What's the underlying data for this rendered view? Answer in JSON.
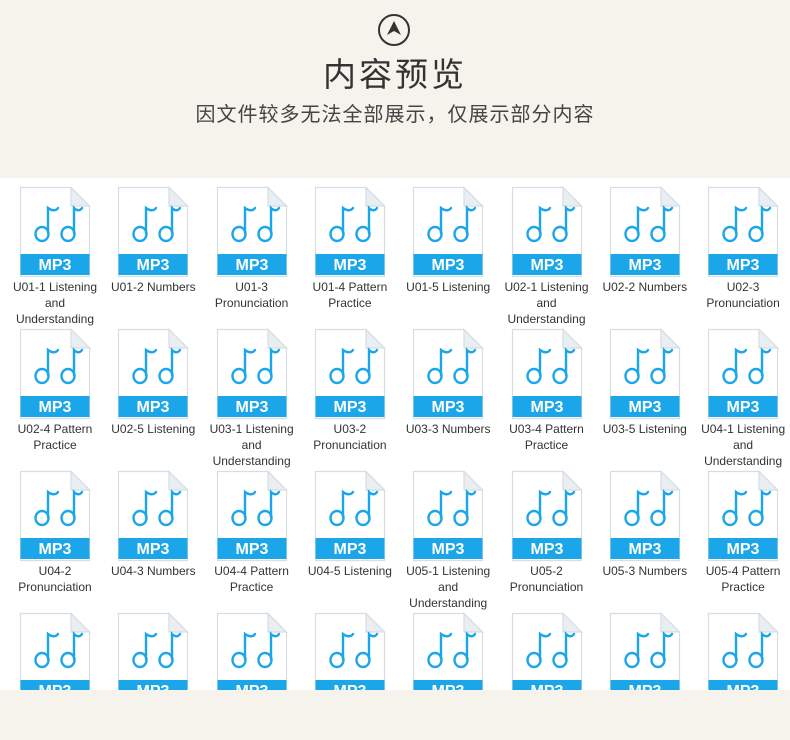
{
  "header": {
    "logo_icon": "arrow-up-circle-icon",
    "title": "内容预览",
    "subtitle": "因文件较多无法全部展示，仅展示部分内容"
  },
  "file_icon": {
    "badge": "MP3",
    "accent": "#1aa6e8",
    "icon": "music-notes-icon"
  },
  "files": [
    "U01-1 Listening and Understanding",
    "U01-2 Numbers",
    "U01-3 Pronunciation",
    "U01-4 Pattern Practice",
    "U01-5 Listening",
    "U02-1 Listening and Understanding",
    "U02-2 Numbers",
    "U02-3 Pronunciation",
    "U02-4 Pattern Practice",
    "U02-5 Listening",
    "U03-1 Listening and Understanding",
    "U03-2 Pronunciation",
    "U03-3 Numbers",
    "U03-4 Pattern Practice",
    "U03-5 Listening",
    "U04-1 Listening and Understanding",
    "U04-2 Pronunciation",
    "U04-3 Numbers",
    "U04-4 Pattern Practice",
    "U04-5 Listening",
    "U05-1 Listening and Understanding",
    "U05-2 Pronunciation",
    "U05-3 Numbers",
    "U05-4 Pattern Practice",
    "",
    "",
    "",
    "",
    "",
    "",
    "",
    ""
  ]
}
